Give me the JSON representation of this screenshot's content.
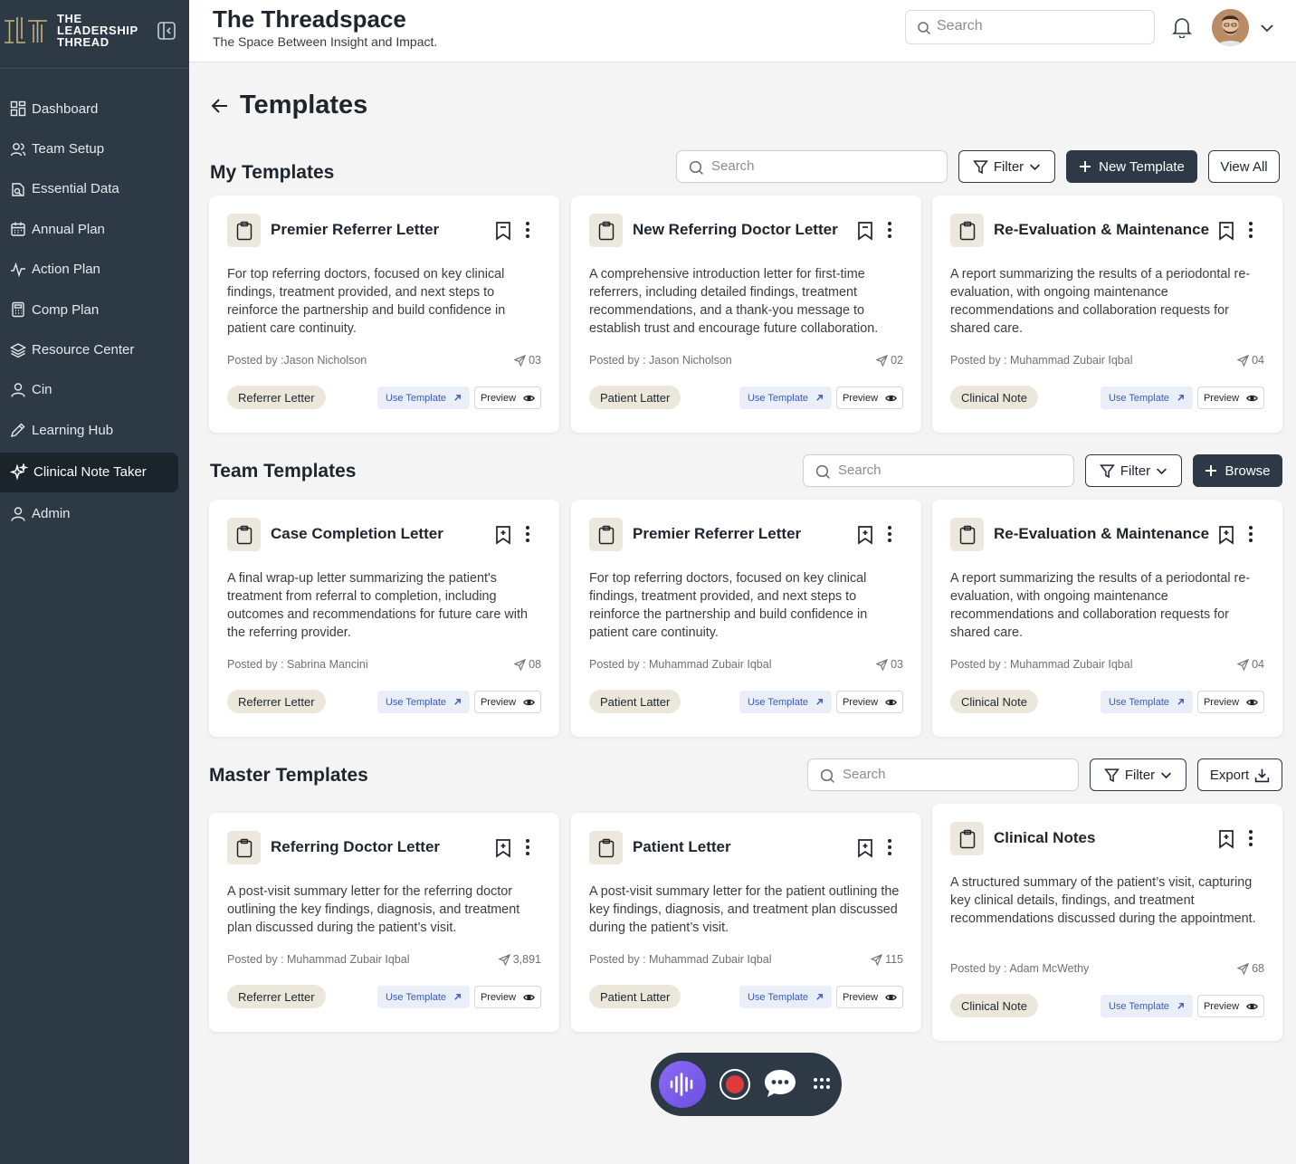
{
  "brand": {
    "line1": "THE",
    "line2": "LEADERSHIP",
    "line3": "THREAD",
    "accent": "#c9b47a"
  },
  "sidebar": {
    "items": [
      {
        "label": "Dashboard",
        "icon": "grid-icon"
      },
      {
        "label": "Team Setup",
        "icon": "users-icon"
      },
      {
        "label": "Essential Data",
        "icon": "database-icon"
      },
      {
        "label": "Annual Plan",
        "icon": "calendar-icon"
      },
      {
        "label": "Action Plan",
        "icon": "activity-icon"
      },
      {
        "label": "Comp Plan",
        "icon": "calculator-icon"
      },
      {
        "label": "Resource Center",
        "icon": "layers-icon"
      },
      {
        "label": "Cin",
        "icon": "user-icon"
      },
      {
        "label": "Learning Hub",
        "icon": "pen-icon"
      },
      {
        "label": "Clinical Note Taker",
        "icon": "sparkle-icon",
        "active": true
      },
      {
        "label": "Admin",
        "icon": "user-icon"
      }
    ]
  },
  "header": {
    "title": "The Threadspace",
    "subtitle": "The Space Between Insight and Impact.",
    "search_placeholder": "Search"
  },
  "page": {
    "title": "Templates"
  },
  "sections": {
    "my": {
      "title": "My Templates",
      "search_placeholder": "Search",
      "filter_label": "Filter",
      "new_label": "New Template",
      "view_all_label": "View All",
      "cards": [
        {
          "title": "Premier Referrer Letter",
          "desc": "For top referring doctors, focused on key clinical findings, treatment provided, and next steps to reinforce the partnership and build confidence in patient care continuity.",
          "posted": "Posted by :Jason Nicholson",
          "count": "03",
          "tag": "Referrer Letter"
        },
        {
          "title": "New Referring Doctor Letter",
          "desc": "A comprehensive introduction letter for first-time referrers, including detailed findings, treatment recommendations, and a thank-you message to establish trust and encourage future collaboration.",
          "posted": "Posted by : Jason Nicholson",
          "count": "02",
          "tag": "Patient Latter"
        },
        {
          "title": "Re-Evaluation & Maintenance",
          "desc": "A report summarizing the results of a periodontal re-evaluation, with ongoing maintenance recommendations and collaboration requests for shared care.",
          "posted": "Posted by : Muhammad Zubair Iqbal",
          "count": "04",
          "tag": "Clinical Note"
        }
      ]
    },
    "team": {
      "title": "Team Templates",
      "search_placeholder": "Search",
      "filter_label": "Filter",
      "browse_label": "Browse",
      "cards": [
        {
          "title": "Case Completion Letter",
          "desc": "A final wrap-up letter summarizing the patient's treatment from referral to completion, including outcomes and recommendations for future care with the referring provider.",
          "posted": "Posted by : Sabrina Mancini",
          "count": "08",
          "tag": "Referrer Letter"
        },
        {
          "title": "Premier Referrer Letter",
          "desc": "For top referring doctors, focused on key clinical findings, treatment provided, and next steps to reinforce the partnership and build confidence in patient care continuity.",
          "posted": "Posted by : Muhammad Zubair Iqbal",
          "count": "03",
          "tag": "Patient Latter"
        },
        {
          "title": "Re-Evaluation & Maintenance",
          "desc": "A report summarizing the results of a periodontal re-evaluation, with ongoing maintenance recommendations and collaboration requests for shared care.",
          "posted": "Posted by : Muhammad Zubair Iqbal",
          "count": "04",
          "tag": "Clinical Note"
        }
      ]
    },
    "master": {
      "title": "Master Templates",
      "search_placeholder": "Search",
      "filter_label": "Filter",
      "export_label": "Export",
      "cards": [
        {
          "title": "Referring Doctor Letter",
          "desc": "A post-visit summary letter for the referring doctor outlining the key findings, diagnosis, and treatment plan discussed during the patient’s visit.",
          "posted": "Posted by : Muhammad Zubair Iqbal",
          "count": "3,891",
          "tag": "Referrer Letter"
        },
        {
          "title": "Patient Letter",
          "desc": "A post-visit summary letter for the patient outlining the key findings, diagnosis, and treatment plan discussed during the patient’s visit.",
          "posted": "Posted by : Muhammad Zubair Iqbal",
          "count": "115",
          "tag": "Patient Latter"
        },
        {
          "title": "Clinical Notes",
          "desc": "A structured summary of the patient’s visit, capturing key clinical details, findings, and treatment recommendations discussed during the appointment.",
          "posted": "Posted by : Adam McWethy",
          "count": "68",
          "tag": "Clinical Note"
        }
      ]
    }
  },
  "card_actions": {
    "use_label": "Use Template",
    "preview_label": "Preview"
  },
  "colors": {
    "sidebar_bg": "#2d3a46",
    "primary": "#2d3a46",
    "tag_bg": "#ebe7da",
    "use_bg": "#e9eef9",
    "voice": "#7a5cf0",
    "record": "#e0393e"
  },
  "toolbar": {
    "icons": [
      "voice-wave-icon",
      "record-icon",
      "chat-icon",
      "more-dots-icon"
    ]
  }
}
